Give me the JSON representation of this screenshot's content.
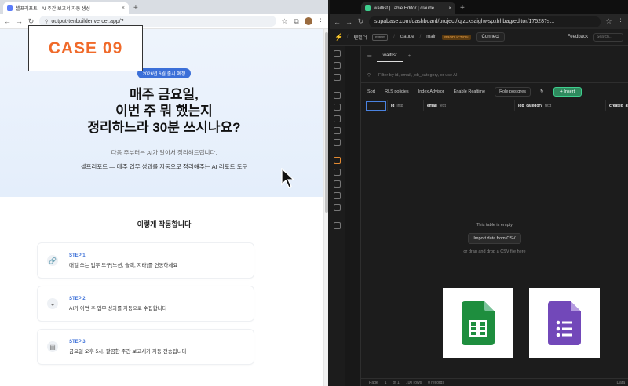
{
  "left_browser": {
    "tab_title": "셀프리포트 - AI 주간 보고서 자동 생성",
    "url": "output-tenbuilder.vercel.app/?"
  },
  "case_badge": "CASE 09",
  "hero": {
    "pill": "2026년 6월 출시 예정",
    "headline_1": "매주 금요일,",
    "headline_2": "이번 주 뭐 했는지",
    "headline_3": "정리하느라 30분 쓰시나요?",
    "sub_1": "다음 주부터는 AI가 알아서 정리해드립니다.",
    "sub_2": "셀프리포트 — 매주 업무 성과를 자동으로 정리해주는 AI 리포트 도구"
  },
  "how": {
    "title": "이렇게 작동합니다",
    "steps": [
      {
        "num": "STEP 1",
        "desc": "매일 쓰는 업무 도구(노션, 슬랙, 지라)를 연동하세요"
      },
      {
        "num": "STEP 2",
        "desc": "AI가 이번 주 업무 성과를 자동으로 수집합니다"
      },
      {
        "num": "STEP 3",
        "desc": "금요일 오후 5시, 깔끔한 주간 보고서가 자동 전송됩니다"
      }
    ]
  },
  "right_browser": {
    "tab_title": "waitlist | Table Editor | claude",
    "url": "supabase.com/dashboard/project/jqlzcxsaighwspxhhbag/editor/17528?s..."
  },
  "supabase": {
    "org": "텐빌더",
    "org_badge": "FREE",
    "project": "claude",
    "branch": "main",
    "branch_badge": "PRODUCTION",
    "connect": "Connect",
    "feedback": "Feedback",
    "search": "Search...",
    "table_tab": "waitlist",
    "filter_placeholder": "Filter by id, email, job_category, or use AI",
    "toolbar": {
      "sort": "Sort",
      "rls": "RLS policies",
      "index": "Index Advisor",
      "realtime": "Enable Realtime",
      "role": "Role postgres",
      "insert": "+ Insert"
    },
    "columns": [
      {
        "name": "id",
        "type": "int8"
      },
      {
        "name": "email",
        "type": "text"
      },
      {
        "name": "job_category",
        "type": "text"
      },
      {
        "name": "created_at",
        "type": "tim"
      }
    ],
    "empty_title": "This table is empty",
    "import_btn": "Import data from CSV",
    "drag_text": "or drag and drop a CSV file here",
    "footer": {
      "page_label": "Page",
      "page": "1",
      "of": "of 1",
      "rows": "100 rows",
      "records": "0 records",
      "data": "Data"
    }
  },
  "colors": {
    "supabase_green": "#3ecf8e",
    "case_orange": "#f06a2a",
    "sheets_green": "#1e8e3e",
    "forms_purple": "#7248b9"
  }
}
